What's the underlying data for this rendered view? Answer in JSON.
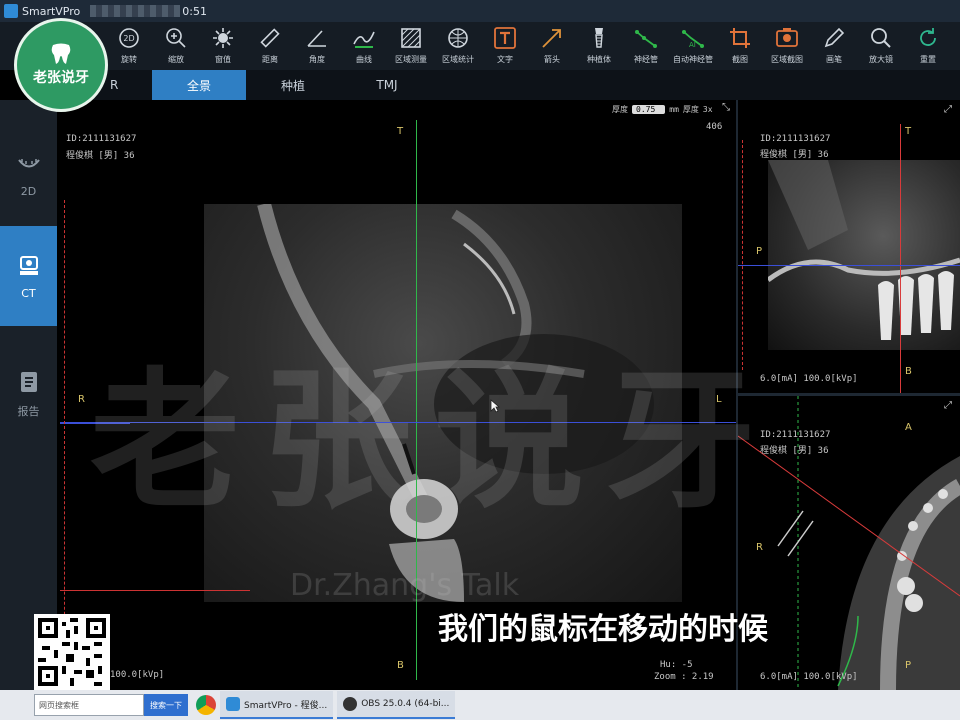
{
  "window": {
    "app_name": "SmartVPro",
    "time_fragment": "0:51"
  },
  "toolbar": {
    "items": [
      {
        "label": "旋转",
        "icon": "rotate-2d-icon"
      },
      {
        "label": "缩放",
        "icon": "zoom-icon"
      },
      {
        "label": "窗值",
        "icon": "brightness-icon"
      },
      {
        "label": "距离",
        "icon": "ruler-icon"
      },
      {
        "label": "角度",
        "icon": "angle-icon"
      },
      {
        "label": "曲线",
        "icon": "curve-icon"
      },
      {
        "label": "区域测量",
        "icon": "area-measure-icon"
      },
      {
        "label": "区域统计",
        "icon": "area-stats-icon"
      },
      {
        "label": "文字",
        "icon": "text-icon"
      },
      {
        "label": "箭头",
        "icon": "arrow-icon"
      },
      {
        "label": "种植体",
        "icon": "implant-icon"
      },
      {
        "label": "神经管",
        "icon": "nerve-canal-icon"
      },
      {
        "label": "自动神经管",
        "icon": "auto-nerve-canal-icon"
      },
      {
        "label": "截图",
        "icon": "crop-icon"
      },
      {
        "label": "区域截图",
        "icon": "region-capture-icon"
      },
      {
        "label": "画笔",
        "icon": "pen-icon"
      },
      {
        "label": "放大镜",
        "icon": "magnifier-icon"
      },
      {
        "label": "重置",
        "icon": "reset-icon"
      }
    ]
  },
  "tabs": [
    {
      "label": "R",
      "active": false
    },
    {
      "label": "全景",
      "active": true
    },
    {
      "label": "种植",
      "active": false
    },
    {
      "label": "TMJ",
      "active": false
    }
  ],
  "sidebar": {
    "items": [
      {
        "label": "2D",
        "icon": "arch-icon",
        "active": false
      },
      {
        "label": "CT",
        "icon": "ct-icon",
        "active": true
      },
      {
        "label": "报告",
        "icon": "report-icon",
        "active": false
      }
    ]
  },
  "main_view": {
    "patient_id": "ID:2111131627",
    "patient_name": "程俊棋 [男] 36",
    "thickness_label": "厚度",
    "thickness_value": "0.75",
    "thickness_unit": "mm",
    "density_label": "厚度",
    "density_value": "3x",
    "slice_index": "406",
    "dir_top": "T",
    "dir_bottom": "B",
    "dir_left": "R",
    "dir_right": "L",
    "exposure": "100.0[kVp]",
    "hu": "Hu: -5",
    "zoom": "Zoom : 2.19"
  },
  "right_top": {
    "patient_id": "ID:2111131627",
    "patient_name": "程俊棋 [男] 36",
    "dir_top": "T",
    "dir_left": "P",
    "dir_bottom": "B",
    "exposure": "6.0[mA] 100.0[kVp]"
  },
  "right_bottom": {
    "patient_id": "ID:2111131627",
    "patient_name": "程俊棋 [男] 36",
    "dir_top": "A",
    "dir_left": "R",
    "dir_bottom": "P",
    "exposure": "6.0[mA] 100.0[kVp]"
  },
  "watermark": {
    "big": "老张说牙",
    "small": "Dr.Zhang's Talk"
  },
  "logo": {
    "title": "老张说牙"
  },
  "subtitle": "我们的鼠标在移动的时候",
  "taskbar": {
    "search_placeholder": "网页搜索框",
    "search_button": "搜索一下",
    "apps": [
      {
        "label": "SmartVPro - 程俊...",
        "color": "#2f8bd6"
      },
      {
        "label": "OBS 25.0.4 (64-bi...",
        "color": "#333333"
      }
    ]
  },
  "colors": {
    "accent": "#2f7fc4",
    "toolbar_bg": "#151c24",
    "crosshair_green": "#2fb84a",
    "crosshair_blue": "#3b4fd8",
    "crosshair_red": "#d83b3b"
  }
}
